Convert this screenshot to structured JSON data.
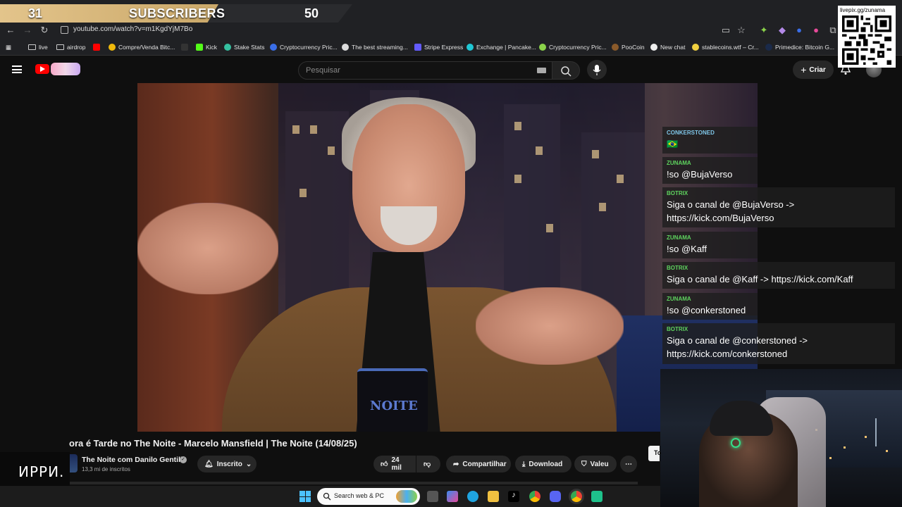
{
  "overlay": {
    "subscriber_count": "31",
    "subscriber_label": "SUBSCRIBERS",
    "subscriber_goal": "50",
    "progress_fraction": 0.62
  },
  "browser": {
    "url": "youtube.com/watch?v=m1KgdYjM7Bo",
    "bookmarks": [
      "live",
      "airdrop",
      "Compre/Venda Bitc...",
      "Kick",
      "Stake Stats",
      "Cryptocurrency Pric...",
      "The best streaming...",
      "Stripe Express",
      "Exchange | Pancake...",
      "Cryptocurrency Pric...",
      "PooCoin",
      "New chat",
      "stablecoins.wtf – Cr...",
      "Primedice: Bitcoin G..."
    ]
  },
  "youtube": {
    "search_placeholder": "Pesquisar",
    "create_label": "Criar"
  },
  "chat": [
    {
      "user": "CONKERSTONED",
      "text": "🇧🇷"
    },
    {
      "user": "ZUNAMA",
      "text": "!so @BujaVerso"
    },
    {
      "user": "BOTRIX",
      "text": "Siga o canal de @BujaVerso -> https://kick.com/BujaVerso"
    },
    {
      "user": "ZUNAMA",
      "text": "!so @Kaff"
    },
    {
      "user": "BOTRIX",
      "text": "Siga o canal de @Kaff -> https://kick.com/Kaff"
    },
    {
      "user": "ZUNAMA",
      "text": "!so @conkerstoned"
    },
    {
      "user": "BOTRIX",
      "text": "Siga o canal de @conkerstoned -> https://kick.com/conkerstoned"
    }
  ],
  "qr": {
    "label": "livepix.gg/zunama"
  },
  "video": {
    "mug_text": "NOITE",
    "title": "ora é Tarde no The Noite - Marcelo Mansfield | The Noite (14/08/25)",
    "channel": "The Noite com Danilo Gentili",
    "subscribers": "13,3 mi de inscritos",
    "subscribed_label": "Inscrito",
    "likes": "24 mil",
    "share_label": "Compartilhar",
    "download_label": "Download",
    "thanks_label": "Valeu",
    "tooltip_fragment": "To"
  },
  "stream_logo": "ИPPИ.",
  "taskbar": {
    "search_placeholder": "Search web & PC"
  }
}
